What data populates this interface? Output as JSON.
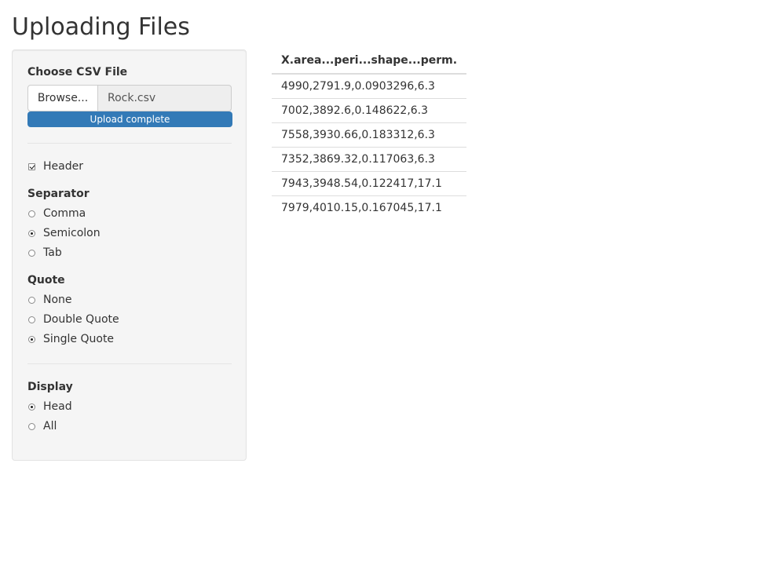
{
  "page": {
    "title": "Uploading Files"
  },
  "sidebar": {
    "file_label": "Choose CSV File",
    "browse_label": "Browse...",
    "file_name": "Rock.csv",
    "progress_text": "Upload complete",
    "progress_percent": 100,
    "header_label": "Header",
    "header_checked": true,
    "separator": {
      "label": "Separator",
      "options": [
        "Comma",
        "Semicolon",
        "Tab"
      ],
      "selected": "Semicolon"
    },
    "quote": {
      "label": "Quote",
      "options": [
        "None",
        "Double Quote",
        "Single Quote"
      ],
      "selected": "Single Quote"
    },
    "display": {
      "label": "Display",
      "options": [
        "Head",
        "All"
      ],
      "selected": "Head"
    }
  },
  "table": {
    "header": "X.area...peri...shape...perm.",
    "rows": [
      "4990,2791.9,0.0903296,6.3",
      "7002,3892.6,0.148622,6.3",
      "7558,3930.66,0.183312,6.3",
      "7352,3869.32,0.117063,6.3",
      "7943,3948.54,0.122417,17.1",
      "7979,4010.15,0.167045,17.1"
    ]
  },
  "colors": {
    "progress_fill": "#337ab7",
    "panel_background": "#f5f5f5"
  }
}
